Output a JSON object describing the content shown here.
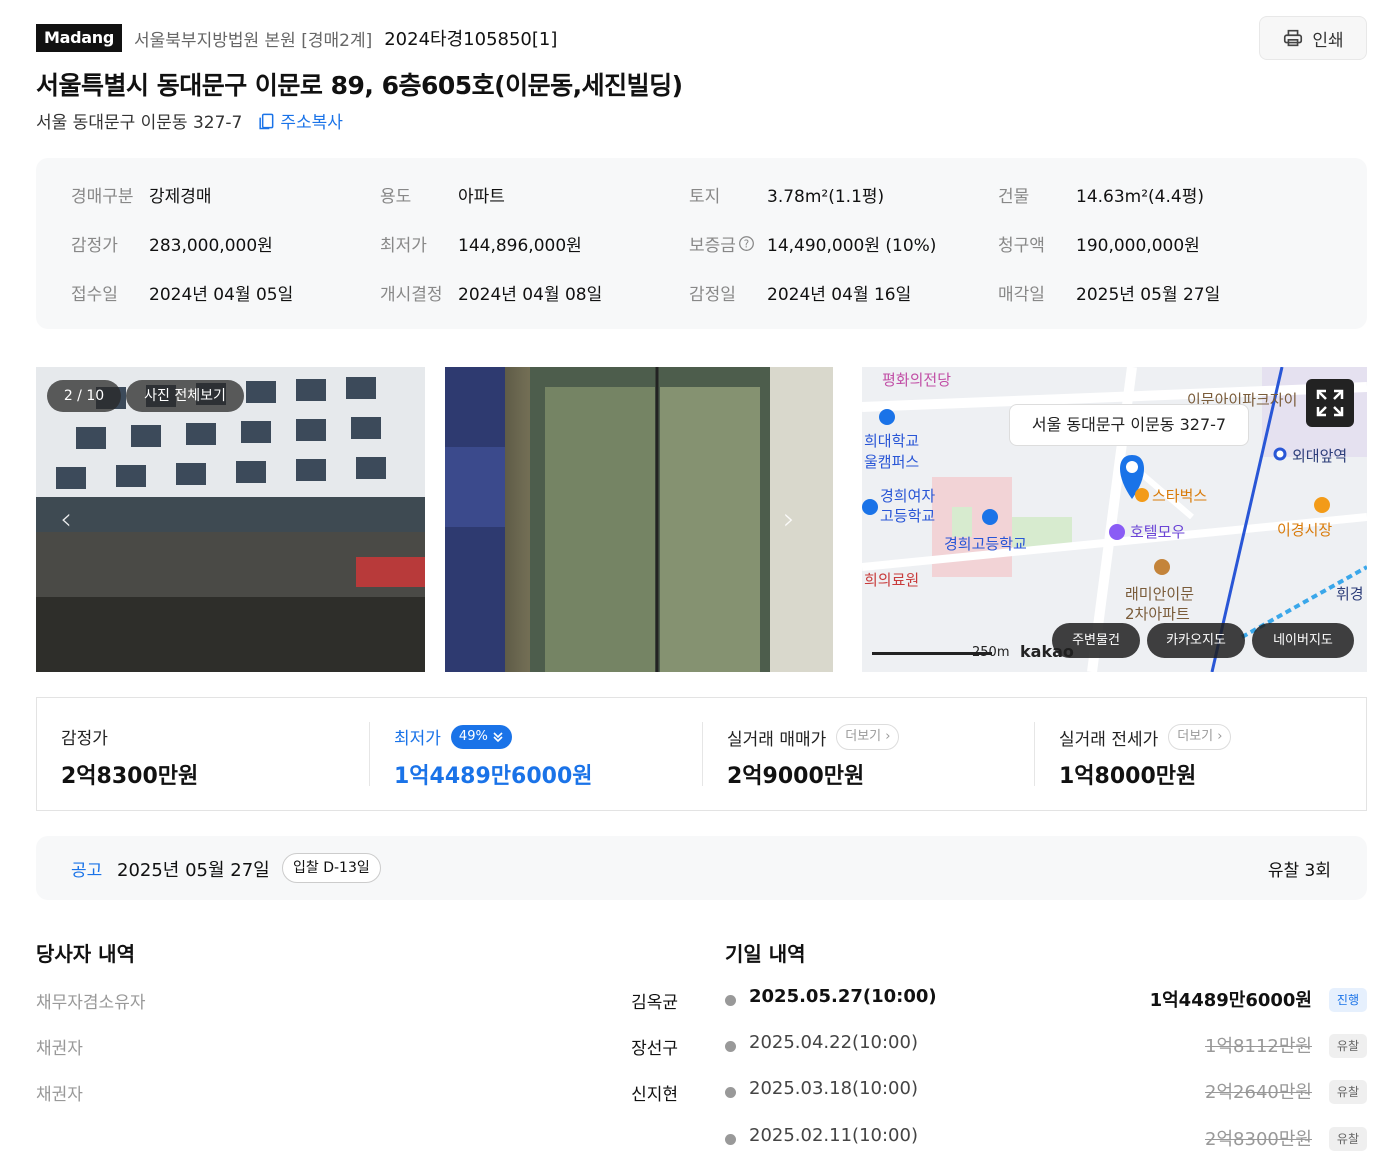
{
  "header": {
    "logo": "Madang",
    "court": "서울북부지방법원 본원 [경매2계]",
    "case_no": "2024타경105850[1]",
    "print_label": "인쇄",
    "title": "서울특별시 동대문구 이문로 89, 6층605호(이문동,세진빌딩)",
    "sub_address": "서울 동대문구 이문동 327-7",
    "copy_label": "주소복사"
  },
  "info": [
    {
      "k": "경매구분",
      "v": "강제경매"
    },
    {
      "k": "용도",
      "v": "아파트"
    },
    {
      "k": "토지",
      "v": "3.78m²(1.1평)"
    },
    {
      "k": "건물",
      "v": "14.63m²(4.4평)"
    },
    {
      "k": "감정가",
      "v": "283,000,000원"
    },
    {
      "k": "최저가",
      "v": "144,896,000원"
    },
    {
      "k": "보증금",
      "v": "14,490,000원 (10%)"
    },
    {
      "k": "청구액",
      "v": "190,000,000원"
    },
    {
      "k": "접수일",
      "v": "2024년 04월 05일"
    },
    {
      "k": "개시결정",
      "v": "2024년 04월 08일"
    },
    {
      "k": "감정일",
      "v": "2024년 04월 16일"
    },
    {
      "k": "매각일",
      "v": "2025년 05월 27일"
    }
  ],
  "photos": {
    "counter": "2 / 10",
    "view_all": "사진 전체보기"
  },
  "map": {
    "tooltip": "서울 동대문구 이문동 327-7",
    "labels": [
      "평화의전당",
      "이문아이파크자이",
      "희대학교",
      "울캠퍼스",
      "외대앞역",
      "경희여자",
      "고등학교",
      "스타벅스",
      "이경시장",
      "경희고등학교",
      "호텔모우",
      "희의료원",
      "래미안이문",
      "2차아파트",
      "휘경"
    ],
    "scale": "250m",
    "brand": "kakao",
    "btn_nearby": "주변물건",
    "btn_kakao": "카카오지도",
    "btn_naver": "네이버지도"
  },
  "price": {
    "appraisal_label": "감정가",
    "appraisal_value": "2억8300만원",
    "min_label": "최저가",
    "min_pct": "49%",
    "min_value": "1억4489만6000원",
    "sale_label": "실거래 매매가",
    "sale_more": "더보기",
    "sale_value": "2억9000만원",
    "rent_label": "실거래 전세가",
    "rent_more": "더보기",
    "rent_value": "1억8000만원"
  },
  "notice": {
    "label": "공고",
    "date": "2025년 05월 27일",
    "dday": "입찰 D-13일",
    "fail_count": "유찰 3회"
  },
  "parties": {
    "title": "당사자 내역",
    "rows": [
      {
        "role": "채무자겸소유자",
        "name": "김옥균"
      },
      {
        "role": "채권자",
        "name": "장선구"
      },
      {
        "role": "채권자",
        "name": "신지현"
      }
    ]
  },
  "schedule": {
    "title": "기일 내역",
    "rows": [
      {
        "date": "2025.05.27(10:00)",
        "price": "1억4489만6000원",
        "status": "진행"
      },
      {
        "date": "2025.04.22(10:00)",
        "price": "1억8112만원",
        "status": "유찰"
      },
      {
        "date": "2025.03.18(10:00)",
        "price": "2억2640만원",
        "status": "유찰"
      },
      {
        "date": "2025.02.11(10:00)",
        "price": "2억8300만원",
        "status": "유찰"
      }
    ]
  },
  "colors": {
    "accent": "#1a73e8",
    "muted": "#888888"
  }
}
